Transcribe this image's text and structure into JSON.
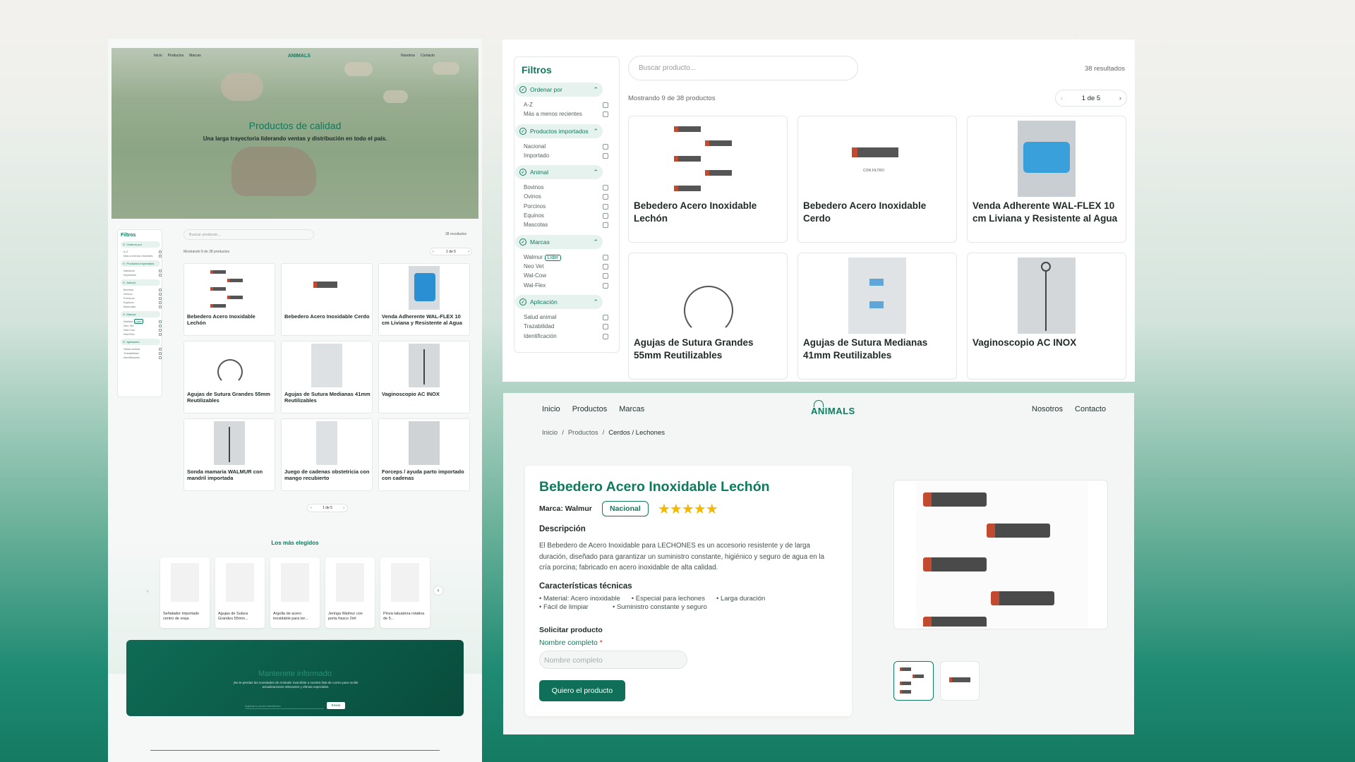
{
  "colors": {
    "brand": "#0f7a5d",
    "dark_panel": "#0b5a48",
    "star": "#f5b800"
  },
  "listing": {
    "nav": {
      "left": [
        "Inicio",
        "Productos",
        "Marcas"
      ],
      "right": [
        "Nosotros",
        "Contacto"
      ],
      "logo": "ANIMALS"
    },
    "hero": {
      "title": "Productos de calidad",
      "subtitle": "Una larga trayectoria liderando ventas y distribución en todo el país."
    },
    "filters_title": "Filtros",
    "search_placeholder": "Buscar producto...",
    "results": "38 resultados",
    "showing": "Mostrando 9 de 38 productos",
    "pager": "1 de 5",
    "filter_groups": [
      {
        "title": "Ordenar por",
        "options": [
          "A-Z",
          "Más a menos recientes"
        ]
      },
      {
        "title": "Productos importados",
        "options": [
          "Nacional",
          "Importado"
        ]
      },
      {
        "title": "Animal",
        "options": [
          "Bovinos",
          "Ovinos",
          "Porcinos",
          "Equinos",
          "Mascotas"
        ]
      },
      {
        "title": "Marcas",
        "options": [
          "Walmur",
          "Neo Vet",
          "Wal-Cow",
          "Wal-Flex"
        ],
        "badge": "Líder"
      },
      {
        "title": "Aplicación",
        "options": [
          "Salud animal",
          "Trazabilidad",
          "Identificación"
        ]
      }
    ],
    "products": [
      "Bebedero Acero Inoxidable Lechón",
      "Bebedero Acero Inoxidable Cerdo",
      "Venda Adherente WAL-FLEX 10 cm Liviana y Resistente al Agua",
      "Agujas de Sutura Grandes 55mm Reutilizables",
      "Agujas de Sutura Medianas 41mm Reutilizables",
      "Vaginoscopio AC INOX",
      "Sonda mamaria WALMUR con mandril importada",
      "Juego de cadenas obstetricia con mango recubierto",
      "Forceps / ayuda parto importado con cadenas"
    ],
    "img_caption": "CON FILTRO",
    "top_title": "Los más elegidos",
    "top": [
      "Señalador importado centro de oreja",
      "Agujas de Sutura Grandes 55mm...",
      "Argolla de acero inoxidable para tor...",
      "Jeringa Walmur con porta frasco 2ml",
      "Pinza tatuadora rotativa de 5..."
    ],
    "news": {
      "title": "Mantenete informado",
      "text": "¡No te pierdas las novedades de Animals! Suscribite a nuestra lista de correo para recibir actualizaciones relevantes y ofertas especiales.",
      "placeholder": "Ingresá tu correo electrónico",
      "button": "Enviar"
    }
  },
  "detail": {
    "nav": {
      "left": [
        "Inicio",
        "Productos",
        "Marcas"
      ],
      "right": [
        "Nosotros",
        "Contacto"
      ],
      "logo": "ANIMALS"
    },
    "breadcrumb": [
      "Inicio",
      "Productos",
      "Cerdos / Lechones"
    ],
    "sep": "/",
    "title": "Bebedero Acero Inoxidable Lechón",
    "brand_label": "Marca: Walmur",
    "badge": "Nacional",
    "rating": 5,
    "stars": "★★★★★",
    "desc_title": "Descripción",
    "desc": "El Bebedero de Acero Inoxidable para LECHONES es un accesorio resistente y de larga duración, diseñado para garantizar un suministro constante, higiénico y seguro de agua en la cría porcina; fabricado en acero inoxidable de alta calidad.",
    "tech_title": "Características técnicas",
    "tech": [
      "Material: Acero inoxidable",
      "Especial para lechones",
      "Larga duración",
      "Fácil de limpiar",
      "Suministro constante y seguro"
    ],
    "form_title": "Solicitar producto",
    "name_label": "Nombre completo",
    "required": "*",
    "name_placeholder": "Nombre completo",
    "button": "Quiero el producto"
  },
  "icons": {
    "check": "check-circle-icon",
    "up": "chevron-up-icon",
    "left": "chevron-left-icon",
    "right": "chevron-right-icon",
    "prev": "‹",
    "next": "›",
    "up_glyph": "⌃"
  }
}
